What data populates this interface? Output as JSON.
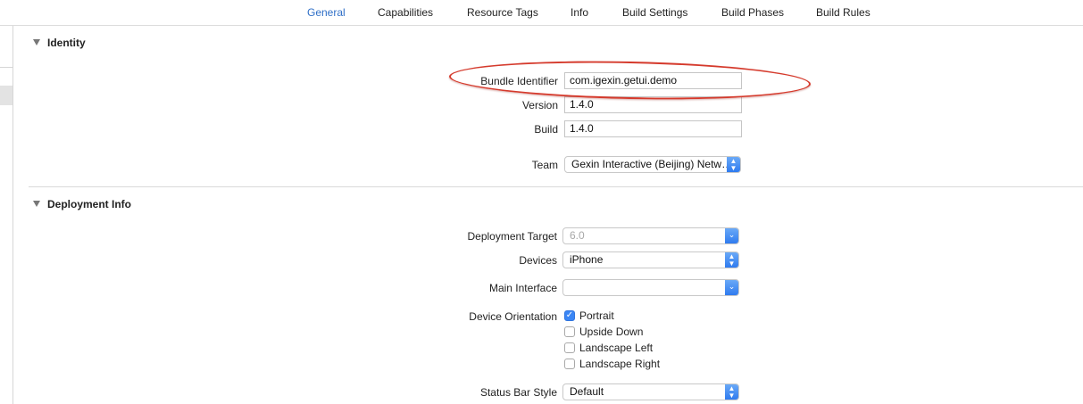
{
  "tabs": [
    {
      "label": "General",
      "active": true
    },
    {
      "label": "Capabilities",
      "active": false
    },
    {
      "label": "Resource Tags",
      "active": false
    },
    {
      "label": "Info",
      "active": false
    },
    {
      "label": "Build Settings",
      "active": false
    },
    {
      "label": "Build Phases",
      "active": false
    },
    {
      "label": "Build Rules",
      "active": false
    }
  ],
  "identity": {
    "title": "Identity",
    "bundle_identifier_label": "Bundle Identifier",
    "bundle_identifier_value": "com.igexin.getui.demo",
    "version_label": "Version",
    "version_value": "1.4.0",
    "build_label": "Build",
    "build_value": "1.4.0",
    "team_label": "Team",
    "team_value": "Gexin Interactive (Beijing) Netw…"
  },
  "deployment": {
    "title": "Deployment Info",
    "target_label": "Deployment Target",
    "target_value": "6.0",
    "devices_label": "Devices",
    "devices_value": "iPhone",
    "main_interface_label": "Main Interface",
    "main_interface_value": "",
    "orientation_label": "Device Orientation",
    "orientations": [
      {
        "label": "Portrait",
        "checked": true
      },
      {
        "label": "Upside Down",
        "checked": false
      },
      {
        "label": "Landscape Left",
        "checked": false
      },
      {
        "label": "Landscape Right",
        "checked": false
      }
    ],
    "status_bar_label": "Status Bar Style",
    "status_bar_value": "Default"
  },
  "colors": {
    "accent": "#2f6fc7",
    "annotation": "#d53a2c",
    "stepper": "#3a86f5"
  },
  "icons": {
    "stepper": "up-down-chevron-icon",
    "dropdown": "chevron-down-icon",
    "disclosure": "disclosure-triangle-icon",
    "check": "checkmark-icon"
  }
}
